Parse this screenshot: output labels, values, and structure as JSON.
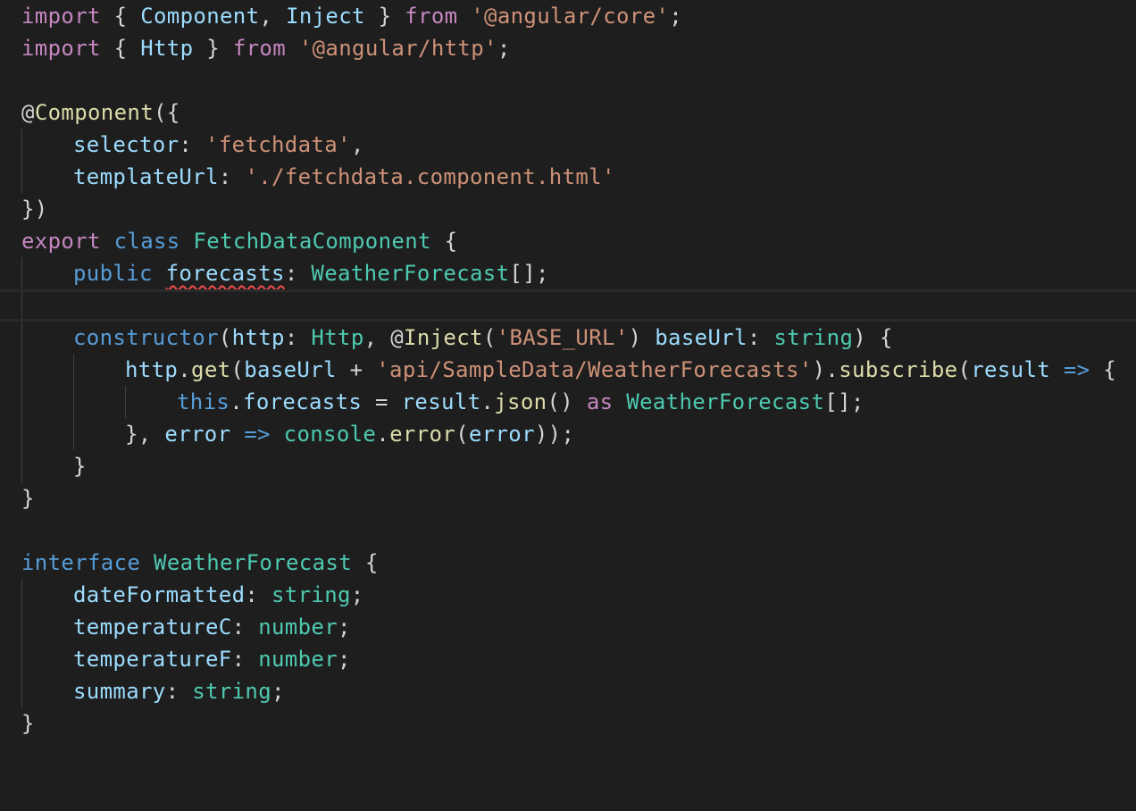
{
  "theme": {
    "background": "#1e1e1e",
    "colors": {
      "keyword": "#c586c0",
      "storage": "#569cd6",
      "type": "#4ec9b0",
      "variable": "#9cdcfe",
      "function": "#dcdcaa",
      "string": "#ce9178",
      "plain": "#d4d4d4",
      "indent_guide": "#404040",
      "error_squiggle": "#f14c4c"
    }
  },
  "editor": {
    "current_line": 9,
    "lines": [
      {
        "indent": 0,
        "tokens": [
          {
            "t": "import",
            "c": "keyword"
          },
          {
            "t": " { ",
            "c": "plain"
          },
          {
            "t": "Component",
            "c": "variable"
          },
          {
            "t": ", ",
            "c": "plain"
          },
          {
            "t": "Inject",
            "c": "variable"
          },
          {
            "t": " } ",
            "c": "plain"
          },
          {
            "t": "from",
            "c": "keyword"
          },
          {
            "t": " ",
            "c": "plain"
          },
          {
            "t": "'@angular/core'",
            "c": "string"
          },
          {
            "t": ";",
            "c": "plain"
          }
        ]
      },
      {
        "indent": 0,
        "tokens": [
          {
            "t": "import",
            "c": "keyword"
          },
          {
            "t": " { ",
            "c": "plain"
          },
          {
            "t": "Http",
            "c": "variable"
          },
          {
            "t": " } ",
            "c": "plain"
          },
          {
            "t": "from",
            "c": "keyword"
          },
          {
            "t": " ",
            "c": "plain"
          },
          {
            "t": "'@angular/http'",
            "c": "string"
          },
          {
            "t": ";",
            "c": "plain"
          }
        ]
      },
      {
        "indent": 0,
        "tokens": []
      },
      {
        "indent": 0,
        "tokens": [
          {
            "t": "@",
            "c": "plain"
          },
          {
            "t": "Component",
            "c": "function"
          },
          {
            "t": "({",
            "c": "plain"
          }
        ]
      },
      {
        "indent": 1,
        "tokens": [
          {
            "t": "selector",
            "c": "variable"
          },
          {
            "t": ": ",
            "c": "plain"
          },
          {
            "t": "'fetchdata'",
            "c": "string"
          },
          {
            "t": ",",
            "c": "plain"
          }
        ]
      },
      {
        "indent": 1,
        "tokens": [
          {
            "t": "templateUrl",
            "c": "variable"
          },
          {
            "t": ": ",
            "c": "plain"
          },
          {
            "t": "'./fetchdata.component.html'",
            "c": "string"
          }
        ]
      },
      {
        "indent": 0,
        "tokens": [
          {
            "t": "})",
            "c": "plain"
          }
        ]
      },
      {
        "indent": 0,
        "tokens": [
          {
            "t": "export",
            "c": "keyword"
          },
          {
            "t": " ",
            "c": "plain"
          },
          {
            "t": "class",
            "c": "storage"
          },
          {
            "t": " ",
            "c": "plain"
          },
          {
            "t": "FetchDataComponent",
            "c": "type"
          },
          {
            "t": " {",
            "c": "plain"
          }
        ]
      },
      {
        "indent": 1,
        "tokens": [
          {
            "t": "public",
            "c": "storage"
          },
          {
            "t": " ",
            "c": "plain"
          },
          {
            "t": "forecasts",
            "c": "variable",
            "squiggle": true
          },
          {
            "t": ": ",
            "c": "plain"
          },
          {
            "t": "WeatherForecast",
            "c": "type"
          },
          {
            "t": "[];",
            "c": "plain"
          }
        ]
      },
      {
        "indent": 1,
        "tokens": []
      },
      {
        "indent": 1,
        "tokens": [
          {
            "t": "constructor",
            "c": "storage"
          },
          {
            "t": "(",
            "c": "plain"
          },
          {
            "t": "http",
            "c": "variable"
          },
          {
            "t": ": ",
            "c": "plain"
          },
          {
            "t": "Http",
            "c": "type"
          },
          {
            "t": ", @",
            "c": "plain"
          },
          {
            "t": "Inject",
            "c": "function"
          },
          {
            "t": "(",
            "c": "plain"
          },
          {
            "t": "'BASE_URL'",
            "c": "string"
          },
          {
            "t": ") ",
            "c": "plain"
          },
          {
            "t": "baseUrl",
            "c": "variable"
          },
          {
            "t": ": ",
            "c": "plain"
          },
          {
            "t": "string",
            "c": "type"
          },
          {
            "t": ") {",
            "c": "plain"
          }
        ]
      },
      {
        "indent": 2,
        "tokens": [
          {
            "t": "http",
            "c": "variable"
          },
          {
            "t": ".",
            "c": "plain"
          },
          {
            "t": "get",
            "c": "function"
          },
          {
            "t": "(",
            "c": "plain"
          },
          {
            "t": "baseUrl",
            "c": "variable"
          },
          {
            "t": " + ",
            "c": "plain"
          },
          {
            "t": "'api/SampleData/WeatherForecasts'",
            "c": "string"
          },
          {
            "t": ").",
            "c": "plain"
          },
          {
            "t": "subscribe",
            "c": "function"
          },
          {
            "t": "(",
            "c": "plain"
          },
          {
            "t": "result",
            "c": "variable"
          },
          {
            "t": " ",
            "c": "plain"
          },
          {
            "t": "=>",
            "c": "storage"
          },
          {
            "t": " {",
            "c": "plain"
          }
        ]
      },
      {
        "indent": 3,
        "tokens": [
          {
            "t": "this",
            "c": "storage"
          },
          {
            "t": ".",
            "c": "plain"
          },
          {
            "t": "forecasts",
            "c": "variable"
          },
          {
            "t": " = ",
            "c": "plain"
          },
          {
            "t": "result",
            "c": "variable"
          },
          {
            "t": ".",
            "c": "plain"
          },
          {
            "t": "json",
            "c": "function"
          },
          {
            "t": "() ",
            "c": "plain"
          },
          {
            "t": "as",
            "c": "keyword"
          },
          {
            "t": " ",
            "c": "plain"
          },
          {
            "t": "WeatherForecast",
            "c": "type"
          },
          {
            "t": "[];",
            "c": "plain"
          }
        ]
      },
      {
        "indent": 2,
        "tokens": [
          {
            "t": "}, ",
            "c": "plain"
          },
          {
            "t": "error",
            "c": "variable"
          },
          {
            "t": " ",
            "c": "plain"
          },
          {
            "t": "=>",
            "c": "storage"
          },
          {
            "t": " ",
            "c": "plain"
          },
          {
            "t": "console",
            "c": "type"
          },
          {
            "t": ".",
            "c": "plain"
          },
          {
            "t": "error",
            "c": "function"
          },
          {
            "t": "(",
            "c": "plain"
          },
          {
            "t": "error",
            "c": "variable"
          },
          {
            "t": "));",
            "c": "plain"
          }
        ]
      },
      {
        "indent": 1,
        "tokens": [
          {
            "t": "}",
            "c": "plain"
          }
        ]
      },
      {
        "indent": 0,
        "tokens": [
          {
            "t": "}",
            "c": "plain"
          }
        ]
      },
      {
        "indent": 0,
        "tokens": []
      },
      {
        "indent": 0,
        "tokens": [
          {
            "t": "interface",
            "c": "storage"
          },
          {
            "t": " ",
            "c": "plain"
          },
          {
            "t": "WeatherForecast",
            "c": "type"
          },
          {
            "t": " {",
            "c": "plain"
          }
        ]
      },
      {
        "indent": 1,
        "tokens": [
          {
            "t": "dateFormatted",
            "c": "variable"
          },
          {
            "t": ": ",
            "c": "plain"
          },
          {
            "t": "string",
            "c": "type"
          },
          {
            "t": ";",
            "c": "plain"
          }
        ]
      },
      {
        "indent": 1,
        "tokens": [
          {
            "t": "temperatureC",
            "c": "variable"
          },
          {
            "t": ": ",
            "c": "plain"
          },
          {
            "t": "number",
            "c": "type"
          },
          {
            "t": ";",
            "c": "plain"
          }
        ]
      },
      {
        "indent": 1,
        "tokens": [
          {
            "t": "temperatureF",
            "c": "variable"
          },
          {
            "t": ": ",
            "c": "plain"
          },
          {
            "t": "number",
            "c": "type"
          },
          {
            "t": ";",
            "c": "plain"
          }
        ]
      },
      {
        "indent": 1,
        "tokens": [
          {
            "t": "summary",
            "c": "variable"
          },
          {
            "t": ": ",
            "c": "plain"
          },
          {
            "t": "string",
            "c": "type"
          },
          {
            "t": ";",
            "c": "plain"
          }
        ]
      },
      {
        "indent": 0,
        "tokens": [
          {
            "t": "}",
            "c": "plain"
          }
        ]
      }
    ]
  }
}
